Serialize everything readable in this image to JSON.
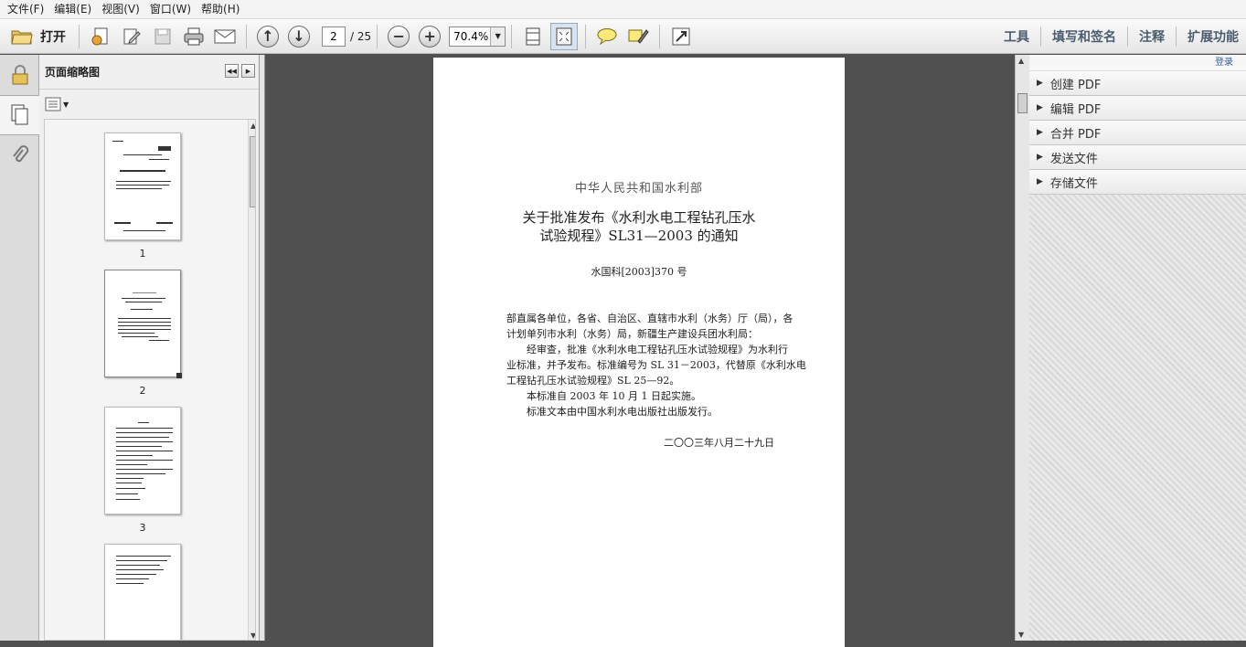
{
  "menu": [
    "文件(F)",
    "编辑(E)",
    "视图(V)",
    "窗口(W)",
    "帮助(H)"
  ],
  "toolbar": {
    "open_label": "打开",
    "page_current": "2",
    "page_total": "/ 25",
    "zoom": "70.4%",
    "right_links": [
      "工具",
      "填写和签名",
      "注释",
      "扩展功能"
    ]
  },
  "thumbnails_panel": {
    "title": "页面缩略图",
    "pages": [
      "1",
      "2",
      "3"
    ]
  },
  "document": {
    "ministry": "中华人民共和国水利部",
    "title_line1": "关于批准发布《水利水电工程钻孔压水",
    "title_line2": "试验规程》SL31—2003 的通知",
    "doc_number": "水国科[2003]370 号",
    "paragraphs": [
      "部直属各单位，各省、自治区、直辖市水利（水务）厅（局），各",
      "计划单列市水利（水务）局，新疆生产建设兵团水利局：",
      "经审查，批准《水利水电工程钻孔压水试验规程》为水利行",
      "业标准，并予发布。标准编号为 SL 31－2003，代替原《水利水电",
      "工程钻孔压水试验规程》SL 25—92。",
      "本标准自 2003 年 10 月 1 日起实施。",
      "标准文本由中国水利水电出版社出版发行。"
    ],
    "date": "二〇〇三年八月二十九日"
  },
  "right_panel": {
    "login": "登录",
    "items": [
      "创建 PDF",
      "编辑 PDF",
      "合并 PDF",
      "发送文件",
      "存储文件"
    ]
  }
}
